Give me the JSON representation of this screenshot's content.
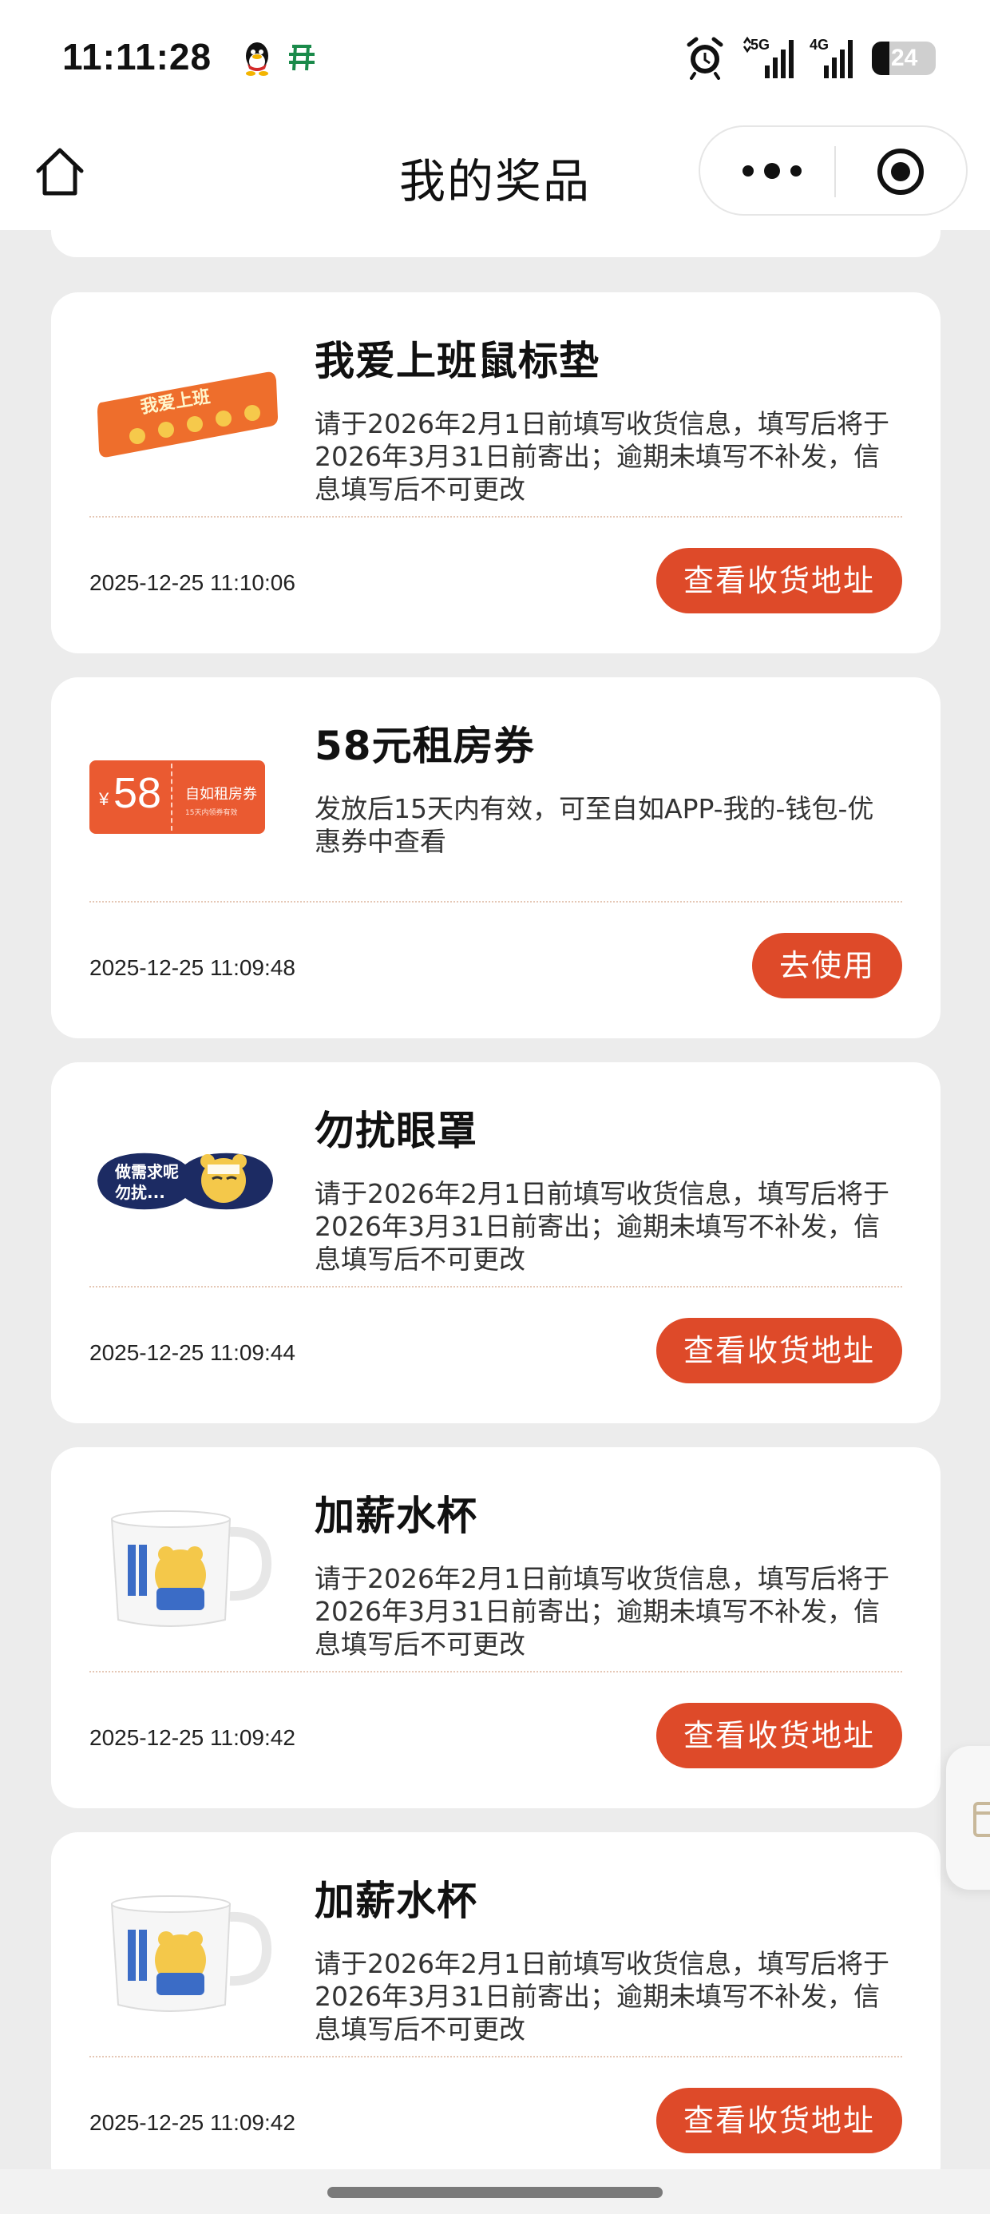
{
  "status_bar": {
    "time": "11:11:28",
    "icons": [
      "qq-icon",
      "wallet-icon",
      "alarm-icon",
      "signal-5g-icon",
      "signal-4g-icon",
      "battery-icon"
    ],
    "network_5g": "5G",
    "network_4g": "4G",
    "battery": "24"
  },
  "nav": {
    "title": "我的奖品",
    "home_icon": "home-icon",
    "more_icon": "more-dots-icon",
    "close_icon": "target-close-icon"
  },
  "prizes": [
    {
      "name": "我爱上班鼠标垫",
      "description": "请于2026年2月1日前填写收货信息，填写后将于2026年3月31日前寄出；逾期未填写不补发，信息填写后不可更改",
      "time": "2025-12-25 11:10:06",
      "action": "查看收货地址",
      "image_text": "我爱上班"
    },
    {
      "name": "58元租房券",
      "description": "发放后15天内有效，可至自如APP-我的-钱包-优惠券中查看",
      "time": "2025-12-25 11:09:48",
      "action": "去使用",
      "coupon": {
        "currency": "¥",
        "amount": "58",
        "label": "自如租房券",
        "sub": "15天内领券有效"
      }
    },
    {
      "name": "勿扰眼罩",
      "description": "请于2026年2月1日前填写收货信息，填写后将于2026年3月31日前寄出；逾期未填写不补发，信息填写后不可更改",
      "time": "2025-12-25 11:09:44",
      "action": "查看收货地址",
      "image_text_1": "做需求呢",
      "image_text_2": "勿扰..."
    },
    {
      "name": "加薪水杯",
      "description": "请于2026年2月1日前填写收货信息，填写后将于2026年3月31日前寄出；逾期未填写不补发，信息填写后不可更改",
      "time": "2025-12-25 11:09:42",
      "action": "查看收货地址"
    },
    {
      "name": "加薪水杯",
      "description": "请于2026年2月1日前填写收货信息，填写后将于2026年3月31日前寄出；逾期未填写不补发，信息填写后不可更改",
      "time": "2025-12-25 11:09:42",
      "action": "查看收货地址"
    }
  ],
  "colors": {
    "accent": "#de4a29",
    "background": "#ececec",
    "card": "#ffffff"
  }
}
